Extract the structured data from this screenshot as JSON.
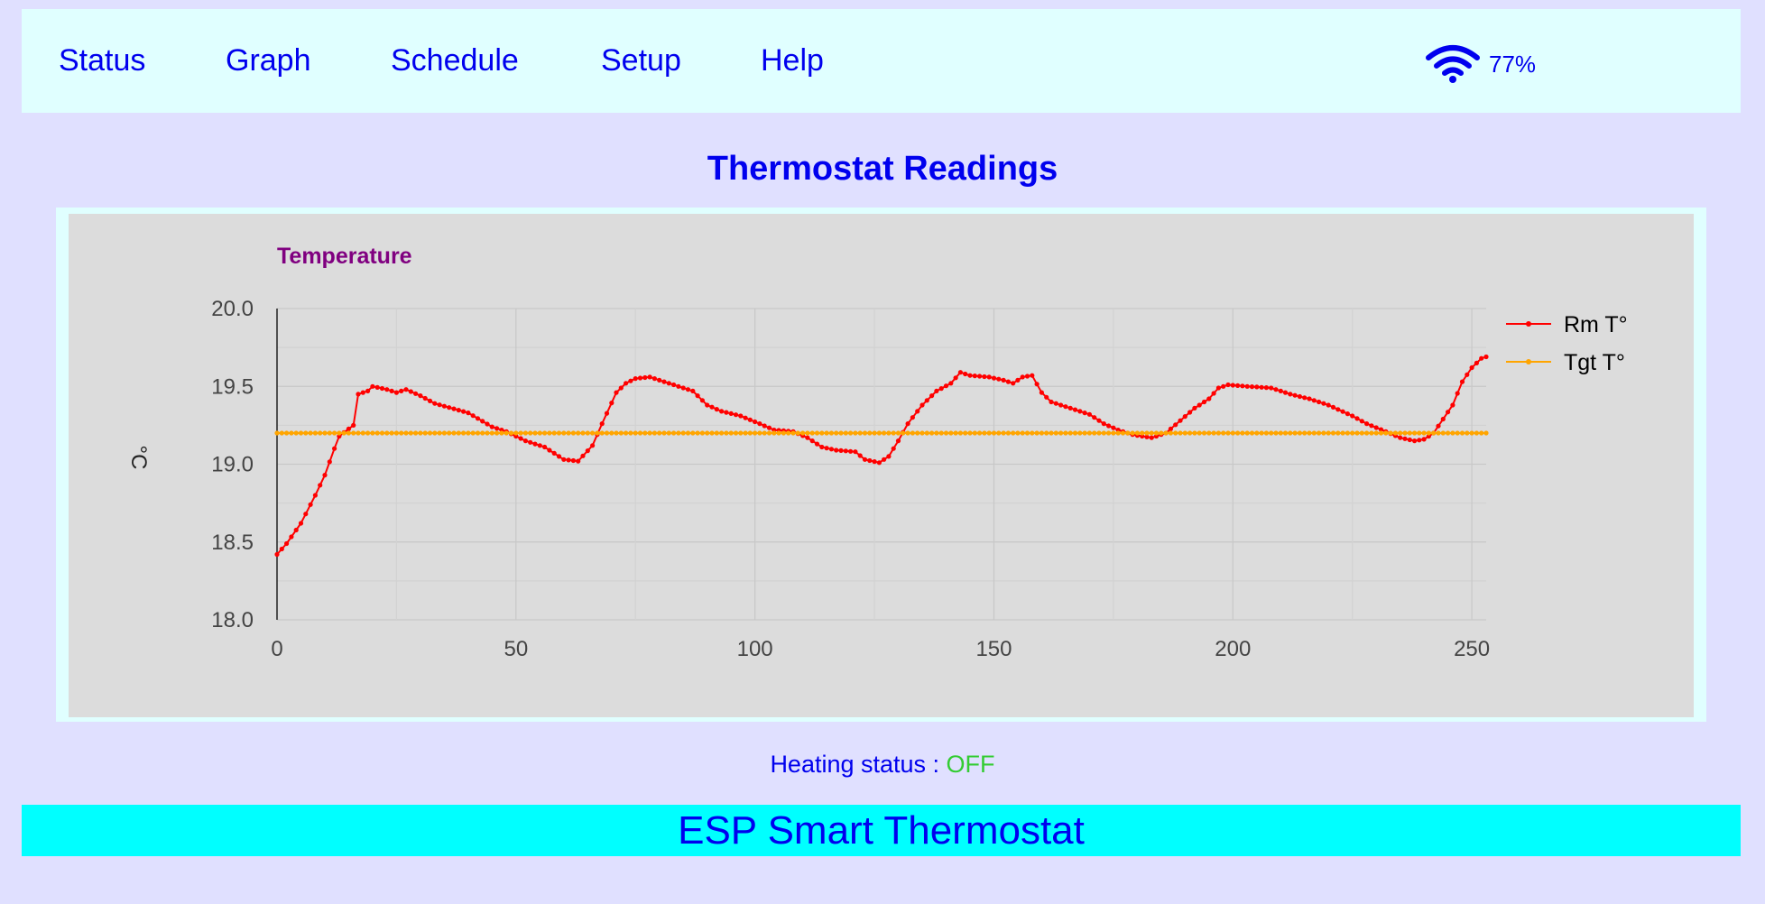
{
  "nav": {
    "items": [
      {
        "label": "Status"
      },
      {
        "label": "Graph"
      },
      {
        "label": "Schedule"
      },
      {
        "label": "Setup"
      },
      {
        "label": "Help"
      }
    ],
    "wifi_icon": "wifi-icon",
    "wifi_strength": "77%"
  },
  "page_title": "Thermostat Readings",
  "heating": {
    "label": "Heating status : ",
    "value": "OFF",
    "value_color": "#33cc33"
  },
  "footer_title": "ESP Smart Thermostat",
  "colors": {
    "page_background": "#e0e0ff",
    "nav_background": "#e0ffff",
    "link": "#0000ee",
    "chart_background": "#dcdcdc",
    "footer_background": "#00ffff",
    "chart_title": "#800080"
  },
  "chart_data": {
    "type": "line",
    "title": "Temperature",
    "ylabel": "°C",
    "xlabel": "",
    "xlim": [
      0,
      253
    ],
    "ylim": [
      18.0,
      20.0
    ],
    "xticks": [
      0,
      50,
      100,
      150,
      200,
      250
    ],
    "yticks": [
      "18.0",
      "18.5",
      "19.0",
      "19.5",
      "20.0"
    ],
    "grid": true,
    "legend_position": "right",
    "series": [
      {
        "name": "Rm T°",
        "color": "#ff0000",
        "anchors": [
          [
            0,
            18.42
          ],
          [
            2,
            18.49
          ],
          [
            5,
            18.62
          ],
          [
            8,
            18.8
          ],
          [
            10,
            18.93
          ],
          [
            12,
            19.1
          ],
          [
            13,
            19.18
          ],
          [
            16,
            19.25
          ],
          [
            17,
            19.45
          ],
          [
            19,
            19.47
          ],
          [
            20,
            19.5
          ],
          [
            23,
            19.48
          ],
          [
            25,
            19.46
          ],
          [
            27,
            19.48
          ],
          [
            30,
            19.44
          ],
          [
            33,
            19.39
          ],
          [
            40,
            19.33
          ],
          [
            45,
            19.24
          ],
          [
            48,
            19.21
          ],
          [
            52,
            19.15
          ],
          [
            56,
            19.11
          ],
          [
            60,
            19.03
          ],
          [
            63,
            19.02
          ],
          [
            66,
            19.12
          ],
          [
            68,
            19.26
          ],
          [
            71,
            19.46
          ],
          [
            73,
            19.52
          ],
          [
            75,
            19.55
          ],
          [
            78,
            19.56
          ],
          [
            82,
            19.52
          ],
          [
            87,
            19.47
          ],
          [
            90,
            19.38
          ],
          [
            93,
            19.34
          ],
          [
            97,
            19.31
          ],
          [
            101,
            19.26
          ],
          [
            104,
            19.22
          ],
          [
            108,
            19.21
          ],
          [
            111,
            19.17
          ],
          [
            114,
            19.11
          ],
          [
            117,
            19.09
          ],
          [
            121,
            19.08
          ],
          [
            123,
            19.03
          ],
          [
            126,
            19.01
          ],
          [
            128,
            19.05
          ],
          [
            130,
            19.15
          ],
          [
            132,
            19.26
          ],
          [
            135,
            19.38
          ],
          [
            138,
            19.47
          ],
          [
            141,
            19.52
          ],
          [
            143,
            19.59
          ],
          [
            145,
            19.57
          ],
          [
            149,
            19.56
          ],
          [
            152,
            19.54
          ],
          [
            154,
            19.52
          ],
          [
            156,
            19.56
          ],
          [
            158,
            19.57
          ],
          [
            160,
            19.46
          ],
          [
            162,
            19.4
          ],
          [
            166,
            19.36
          ],
          [
            170,
            19.32
          ],
          [
            173,
            19.26
          ],
          [
            176,
            19.22
          ],
          [
            179,
            19.19
          ],
          [
            183,
            19.17
          ],
          [
            186,
            19.2
          ],
          [
            189,
            19.28
          ],
          [
            192,
            19.36
          ],
          [
            195,
            19.42
          ],
          [
            197,
            19.49
          ],
          [
            199,
            19.51
          ],
          [
            203,
            19.5
          ],
          [
            208,
            19.49
          ],
          [
            212,
            19.45
          ],
          [
            216,
            19.42
          ],
          [
            220,
            19.38
          ],
          [
            225,
            19.31
          ],
          [
            228,
            19.26
          ],
          [
            232,
            19.21
          ],
          [
            235,
            19.17
          ],
          [
            238,
            19.15
          ],
          [
            240,
            19.16
          ],
          [
            242,
            19.2
          ],
          [
            244,
            19.29
          ],
          [
            246,
            19.38
          ],
          [
            248,
            19.53
          ],
          [
            250,
            19.62
          ],
          [
            252,
            19.68
          ],
          [
            253,
            19.69
          ]
        ]
      },
      {
        "name": "Tgt T°",
        "color": "#ffa500",
        "anchors": [
          [
            0,
            19.2
          ],
          [
            253,
            19.2
          ]
        ]
      }
    ]
  }
}
